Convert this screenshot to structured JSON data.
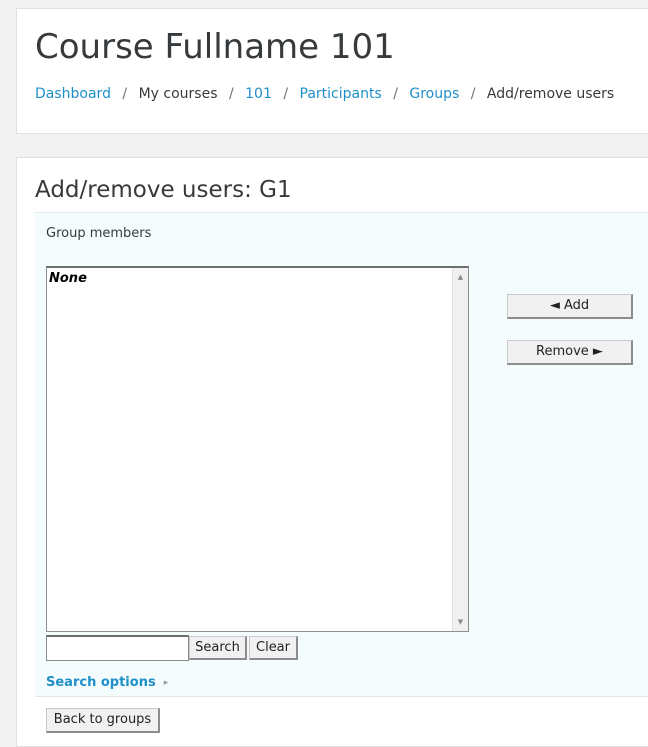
{
  "header": {
    "course_title": "Course Fullname 101",
    "breadcrumb": [
      {
        "label": "Dashboard",
        "link": true
      },
      {
        "label": "My courses",
        "link": false
      },
      {
        "label": "101",
        "link": true
      },
      {
        "label": "Participants",
        "link": true
      },
      {
        "label": "Groups",
        "link": true
      },
      {
        "label": "Add/remove users",
        "link": false
      }
    ],
    "separator": "/"
  },
  "main": {
    "heading": "Add/remove users: G1",
    "group_members_label": "Group members",
    "members_list": {
      "options": [
        "None"
      ],
      "scroll_up_icon": "▲",
      "scroll_down_icon": "▼"
    },
    "add_button": "◄ Add",
    "remove_button": "Remove ►",
    "search": {
      "value": "",
      "placeholder": "",
      "search_button": "Search",
      "clear_button": "Clear"
    },
    "search_options": {
      "label": "Search options",
      "icon": "▸"
    },
    "back_button": "Back to groups"
  },
  "colors": {
    "link": "#1f8fc8",
    "page_background": "#f2f2f2",
    "panel_background": "#f5fcfd"
  }
}
